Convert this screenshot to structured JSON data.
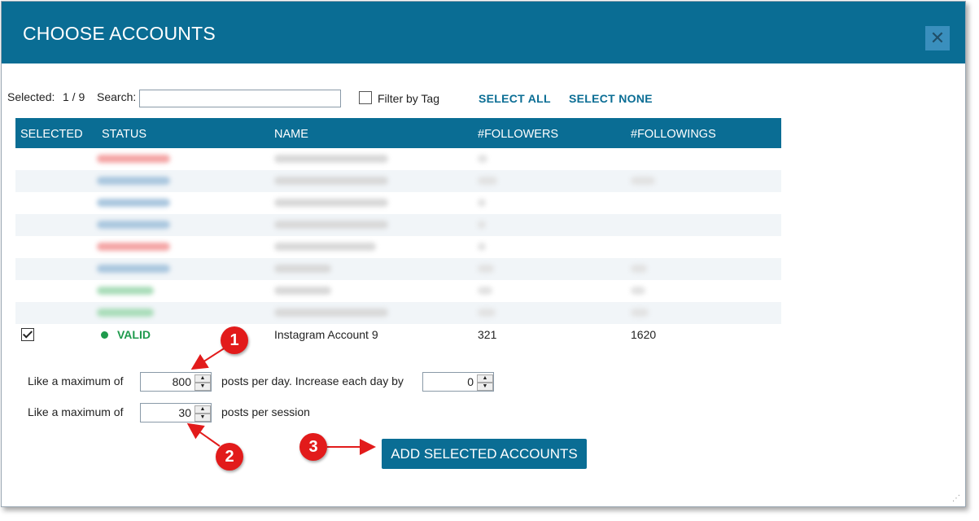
{
  "dialog": {
    "title": "CHOOSE ACCOUNTS",
    "close_label": "✕"
  },
  "toolbar": {
    "selected_label": "Selected:",
    "selected_count": "1 / 9",
    "search_label": "Search:",
    "search_value": "",
    "filter_by_tag": "Filter by Tag",
    "select_all": "SELECT ALL",
    "select_none": "SELECT NONE"
  },
  "table": {
    "columns": [
      "SELECTED",
      "STATUS",
      "NAME",
      "#FOLLOWERS",
      "#FOLLOWINGS"
    ],
    "visible_row": {
      "selected": true,
      "status": "VALID",
      "name": "Instagram Account 9",
      "followers": "321",
      "followings": "1620"
    }
  },
  "settings": {
    "like_max_label_1": "Like a maximum of",
    "posts_per_day_value": "800",
    "posts_per_day_label": "posts per day. Increase each day by",
    "increase_value": "0",
    "like_max_label_2": "Like a maximum of",
    "posts_per_session_value": "30",
    "posts_per_session_label": "posts per session"
  },
  "actions": {
    "add_selected": "ADD SELECTED ACCOUNTS"
  },
  "annotations": {
    "badge_1": "1",
    "badge_2": "2",
    "badge_3": "3"
  },
  "colors": {
    "accent": "#0a6d94",
    "valid": "#1e9a4c",
    "badge": "#e21b1b"
  }
}
